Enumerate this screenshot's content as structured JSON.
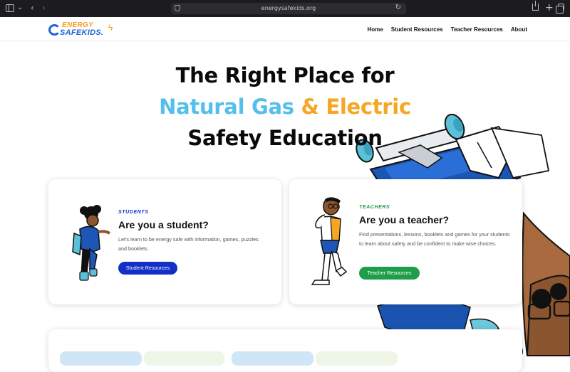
{
  "browser": {
    "url": "energysafekids.org",
    "icons": [
      "sidebar-icon",
      "chevron-down-icon",
      "back-arrow-icon",
      "forward-arrow-icon",
      "shield-icon",
      "reload-icon",
      "share-icon",
      "plus-icon",
      "tabs-overview-icon"
    ]
  },
  "site": {
    "logo_top": "ENERGY",
    "logo_bottom": "SAFEKIDS.",
    "nav": [
      "Home",
      "Student Resources",
      "Teacher Resources",
      "About"
    ]
  },
  "hero": {
    "line1": "The Right Place for",
    "line2_a": "Natural Gas",
    "line2_b": " & Electric",
    "line3": "Safety Education"
  },
  "student_card": {
    "eyebrow": "STUDENTS",
    "title": "Are you a student?",
    "description": "Let's learn to be energy safe with information, games, puzzles and booklets.",
    "button": "Student Resources"
  },
  "teacher_card": {
    "eyebrow": "TEACHERS",
    "title": "Are you a teacher?",
    "description": "Find presentations, lessons, booklets and games for your students to learn about safety and be confident to make wise choices.",
    "button": "Teacher Resources"
  },
  "colors": {
    "brand_blue": "#1f63d6",
    "hero_blue": "#54bfea",
    "hero_orange": "#f5a623",
    "student_button": "#1230c8",
    "teacher_button": "#1f9d4a",
    "students_eyebrow": "#1230c8",
    "teachers_eyebrow": "#1f9d4a"
  }
}
